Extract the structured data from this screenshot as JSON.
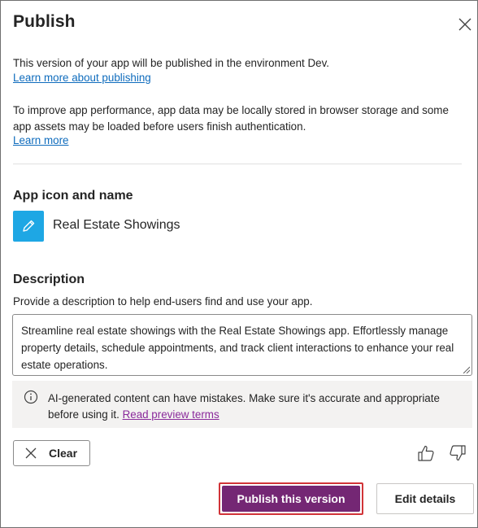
{
  "dialog": {
    "title": "Publish",
    "close_icon": "close-icon"
  },
  "intro": {
    "environment_text": "This version of your app will be published in the environment Dev.",
    "learn_publishing_link": "Learn more about publishing",
    "performance_text": "To improve app performance, app data may be locally stored in browser storage and some app assets may be loaded before users finish authentication.",
    "learn_more_link": "Learn more"
  },
  "app": {
    "heading": "App icon and name",
    "icon": "pencil-icon",
    "icon_color": "#1ea7e4",
    "name": "Real Estate Showings"
  },
  "description": {
    "heading": "Description",
    "hint": "Provide a description to help end-users find and use your app.",
    "value": "Streamline real estate showings with the Real Estate Showings app. Effortlessly manage property details, schedule appointments, and track client interactions to enhance your real estate operations."
  },
  "notice": {
    "icon": "info-icon",
    "text": "AI-generated content can have mistakes. Make sure it's accurate and appropriate before using it.",
    "link": "Read preview terms"
  },
  "actions": {
    "clear_label": "Clear",
    "clear_icon": "close-icon",
    "thumbs_up_icon": "thumbs-up-icon",
    "thumbs_down_icon": "thumbs-down-icon",
    "publish_label": "Publish this version",
    "edit_label": "Edit details",
    "publish_color": "#742774",
    "highlight_color": "#d13438"
  }
}
